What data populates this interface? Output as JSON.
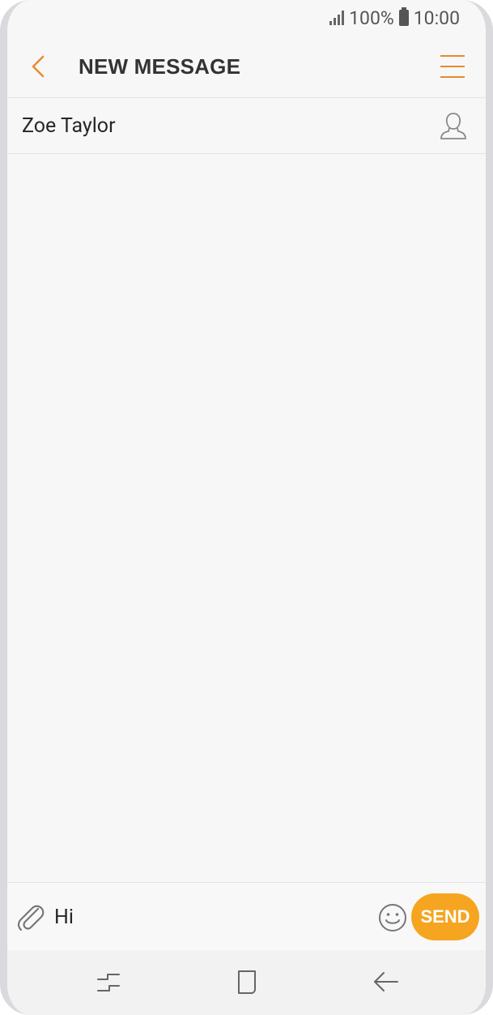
{
  "status_bar": {
    "battery": "100%",
    "time": "10:00"
  },
  "header": {
    "title": "NEW MESSAGE"
  },
  "recipient": {
    "name": "Zoe Taylor"
  },
  "composer": {
    "message_value": "Hi",
    "send_label": "SEND"
  },
  "icons": {
    "back": "chevron-left-icon",
    "menu": "hamburger-menu-icon",
    "contact": "contact-person-icon",
    "attach": "paperclip-icon",
    "emoji": "smiley-icon",
    "recent_apps": "recent-apps-icon",
    "home": "home-icon",
    "back_nav": "back-arrow-icon"
  },
  "colors": {
    "accent": "#e88a2e",
    "send_button": "#f6a521",
    "background": "#f7f7f7"
  }
}
